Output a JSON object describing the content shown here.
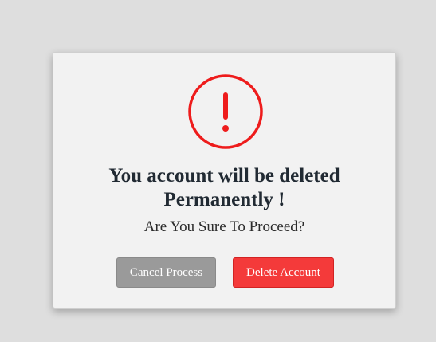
{
  "dialog": {
    "icon": "exclamation-circle-icon",
    "title_line1": "You account will be deleted",
    "title_line2": "Permanently !",
    "subtitle": "Are You Sure To Proceed?",
    "buttons": {
      "cancel_label": "Cancel Process",
      "delete_label": "Delete Account"
    }
  },
  "colors": {
    "page_background": "#dedede",
    "dialog_background": "#f2f2f2",
    "alert_red": "#ee1c1c",
    "cancel_button": "#9a9a9a",
    "delete_button": "#f43a3a",
    "title_text": "#212a33"
  }
}
